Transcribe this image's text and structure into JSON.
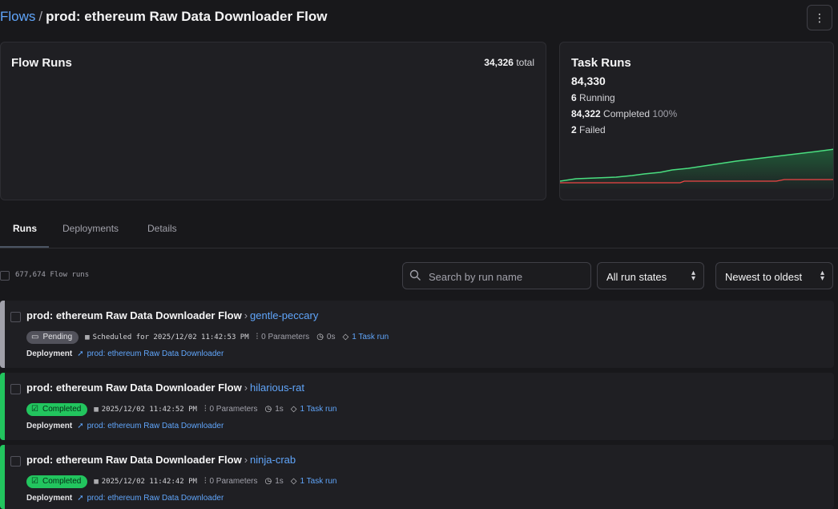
{
  "breadcrumb": {
    "parent": "Flows",
    "separator": "/",
    "title": "prod: ethereum Raw Data Downloader Flow"
  },
  "menu_icon": "vertical-ellipsis",
  "flow_runs_card": {
    "title": "Flow Runs",
    "total_value": "34,326",
    "total_suffix": "total"
  },
  "task_runs_card": {
    "title": "Task Runs",
    "total": "84,330",
    "running_count": "6",
    "running_label": "Running",
    "completed_count": "84,322",
    "completed_label": "Completed",
    "completed_pct": "100%",
    "failed_count": "2",
    "failed_label": "Failed",
    "colors": {
      "completed": "#4ade80",
      "failed": "#ef4444"
    }
  },
  "tabs": [
    {
      "label": "Runs",
      "active": true
    },
    {
      "label": "Deployments",
      "active": false
    },
    {
      "label": "Details",
      "active": false
    }
  ],
  "toolbar": {
    "run_count": "677,674 Flow runs",
    "search_placeholder": "Search by run name",
    "state_filter": "All run states",
    "sort": "Newest to oldest"
  },
  "runs": [
    {
      "flow_name": "prod: ethereum Raw Data Downloader Flow",
      "run_name": "gentle-peccary",
      "state": "Pending",
      "state_color": "#a1a1aa",
      "time": "Scheduled for 2025/12/02 11:42:53 PM",
      "parameters": "0 Parameters",
      "duration": "0s",
      "task_runs": "1 Task run",
      "deployment_label": "Deployment",
      "deployment": "prod: ethereum Raw Data Downloader"
    },
    {
      "flow_name": "prod: ethereum Raw Data Downloader Flow",
      "run_name": "hilarious-rat",
      "state": "Completed",
      "state_color": "#22c55e",
      "time": "2025/12/02 11:42:52 PM",
      "parameters": "0 Parameters",
      "duration": "1s",
      "task_runs": "1 Task run",
      "deployment_label": "Deployment",
      "deployment": "prod: ethereum Raw Data Downloader"
    },
    {
      "flow_name": "prod: ethereum Raw Data Downloader Flow",
      "run_name": "ninja-crab",
      "state": "Completed",
      "state_color": "#22c55e",
      "time": "2025/12/02 11:42:42 PM",
      "parameters": "0 Parameters",
      "duration": "1s",
      "task_runs": "1 Task run",
      "deployment_label": "Deployment",
      "deployment": "prod: ethereum Raw Data Downloader"
    }
  ]
}
